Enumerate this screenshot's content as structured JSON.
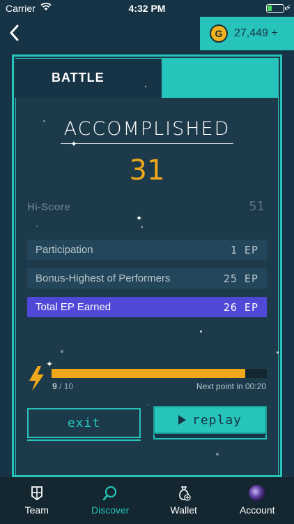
{
  "status_bar": {
    "carrier": "Carrier",
    "time": "4:32 PM"
  },
  "header": {
    "balance": "27,449 +",
    "coin_symbol": "G"
  },
  "card": {
    "tab_label": "BATTLE",
    "title": "ACCOMPLISHED",
    "score": "31",
    "hiscore_label": "Hi-Score",
    "hiscore_value": "51",
    "rows": [
      {
        "label": "Participation",
        "value": "1 EP"
      },
      {
        "label": "Bonus-Highest of Performers",
        "value": "25 EP"
      },
      {
        "label": "Total EP Earned",
        "value": "26 EP"
      }
    ],
    "energy": {
      "current": "9",
      "separator": "/",
      "max": "10",
      "fraction": 0.9
    },
    "next_point": "Next point in 00:20",
    "exit_label": "exit",
    "replay_label": "replay"
  },
  "tabs": [
    {
      "label": "Team",
      "icon": "team-shield-icon",
      "active": false
    },
    {
      "label": "Discover",
      "icon": "search-icon",
      "active": true
    },
    {
      "label": "Wallet",
      "icon": "money-bag-icon",
      "active": false
    },
    {
      "label": "Account",
      "icon": "avatar",
      "active": false
    }
  ],
  "colors": {
    "accent": "#26c4ba",
    "gold": "#f0a81a",
    "total_row": "#5048d6",
    "background": "#173446"
  }
}
